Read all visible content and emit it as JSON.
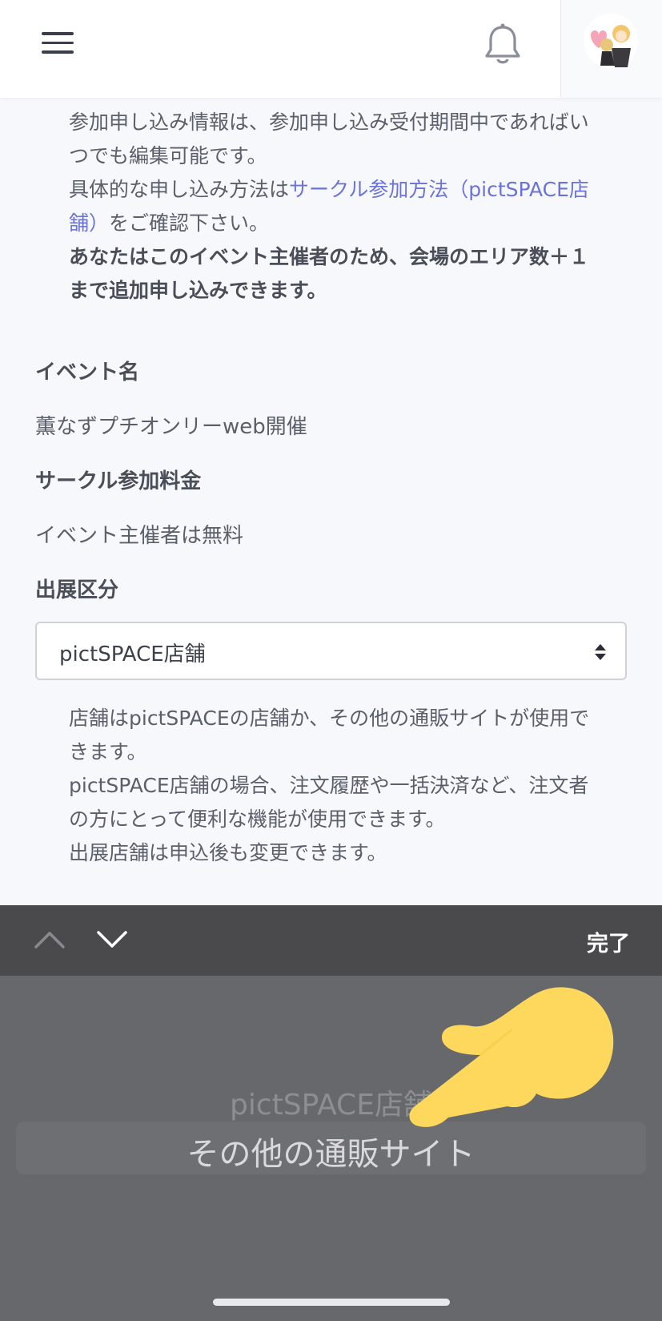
{
  "header": {
    "menu_icon": "hamburger-icon",
    "bell_icon": "bell-icon",
    "avatar_icon": "user-avatar"
  },
  "notes": {
    "edit_info": "参加申し込み情報は、参加申し込み受付期間中であればいつでも編集可能です。",
    "method_prefix": "具体的な申し込み方法は",
    "method_link": "サークル参加方法（pictSPACE店舗）",
    "method_suffix": "をご確認下さい。",
    "organizer_notice": "あなたはこのイベント主催者のため、会場のエリア数＋１まで追加申し込みできます。"
  },
  "event": {
    "name_label": "イベント名",
    "name_value": "薫なずプチオンリーweb開催",
    "fee_label": "サークル参加料金",
    "fee_value": "イベント主催者は無料",
    "category_label": "出展区分",
    "category_selected": "pictSPACE店舗"
  },
  "store_notes": {
    "line1": "店舗はpictSPACEの店舗か、その他の通販サイトが使用できます。",
    "line2": "pictSPACE店舗の場合、注文履歴や一括決済など、注文者の方にとって便利な機能が使用できます。",
    "line3": "出展店舗は申込後も変更できます。"
  },
  "keyboard_toolbar": {
    "prev_icon": "chevron-up-icon",
    "next_icon": "chevron-down-icon",
    "done_label": "完了"
  },
  "picker": {
    "options": [
      "pictSPACE店舗",
      "その他の通販サイト"
    ],
    "highlighted": "その他の通販サイト"
  },
  "colors": {
    "link": "#6b73d8",
    "toolbar": "#4a4a4c",
    "picker_bg": "#67686c",
    "pointer": "#fdd85d"
  }
}
